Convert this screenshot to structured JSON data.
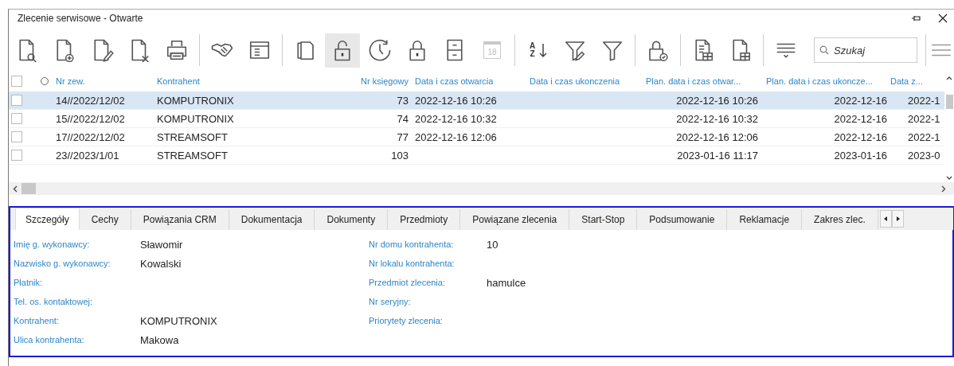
{
  "window": {
    "title": "Zlecenie serwisowe - Otwarte"
  },
  "toolbar": [
    {
      "kind": "doc-search",
      "pressed": false,
      "disabled": false
    },
    {
      "kind": "doc-add",
      "pressed": false,
      "disabled": false
    },
    {
      "kind": "doc-edit",
      "pressed": false,
      "disabled": false
    },
    {
      "kind": "doc-delete",
      "pressed": false,
      "disabled": false
    },
    {
      "kind": "printer",
      "pressed": false,
      "disabled": false
    },
    {
      "kind": "separator"
    },
    {
      "kind": "handshake",
      "pressed": false,
      "disabled": false
    },
    {
      "kind": "form",
      "pressed": false,
      "disabled": false
    },
    {
      "kind": "separator"
    },
    {
      "kind": "copy",
      "pressed": false,
      "disabled": false
    },
    {
      "kind": "unlock",
      "pressed": true,
      "disabled": false
    },
    {
      "kind": "clock",
      "pressed": false,
      "disabled": false
    },
    {
      "kind": "lock",
      "pressed": false,
      "disabled": false
    },
    {
      "kind": "cabinet",
      "pressed": false,
      "disabled": false
    },
    {
      "kind": "calendar",
      "label": "18",
      "pressed": false,
      "disabled": true
    },
    {
      "kind": "separator"
    },
    {
      "kind": "sort",
      "label": "A Z",
      "pressed": false,
      "disabled": false
    },
    {
      "kind": "filter-edit",
      "pressed": false,
      "disabled": false
    },
    {
      "kind": "filter",
      "pressed": false,
      "disabled": false
    },
    {
      "kind": "separator"
    },
    {
      "kind": "lock-check",
      "pressed": false,
      "disabled": false
    },
    {
      "kind": "separator"
    },
    {
      "kind": "doc-table",
      "pressed": false,
      "disabled": false
    },
    {
      "kind": "doc-table-alt",
      "pressed": false,
      "disabled": false
    },
    {
      "kind": "separator"
    },
    {
      "kind": "collapse",
      "pressed": false,
      "disabled": false
    },
    {
      "kind": "search",
      "placeholder": "Szukaj"
    },
    {
      "kind": "separator"
    },
    {
      "kind": "menu",
      "pressed": false,
      "disabled": false
    }
  ],
  "table": {
    "select_all_checked": false,
    "columns": [
      "Nr zew.",
      "Kontrahent",
      "Nr księgowy",
      "Data i czas otwarcia",
      "Data i czas ukonczenia",
      "Plan. data i czas otwar...",
      "Plan. data i czas ukoncze...",
      "Data z..."
    ],
    "rows": [
      {
        "selected": true,
        "checked": false,
        "cells": [
          "14//2022/12/02",
          "KOMPUTRONIX",
          "73",
          "2022-12-16 10:26",
          null,
          "2022-12-16 10:26",
          "2022-12-16",
          "2022-1"
        ]
      },
      {
        "selected": false,
        "checked": false,
        "cells": [
          "15//2022/12/02",
          "KOMPUTRONIX",
          "74",
          "2022-12-16 10:32",
          null,
          "2022-12-16 10:32",
          "2022-12-16",
          "2022-1"
        ]
      },
      {
        "selected": false,
        "checked": false,
        "cells": [
          "17//2022/12/02",
          "STREAMSOFT",
          "77",
          "2022-12-16 12:06",
          null,
          "2022-12-16 12:06",
          "2022-12-16",
          "2022-1"
        ]
      },
      {
        "selected": false,
        "checked": false,
        "cells": [
          "23//2023/1/01",
          "STREAMSOFT",
          "103",
          null,
          null,
          "2023-01-16 11:17",
          "2023-01-16",
          "2023-0"
        ]
      }
    ]
  },
  "tabs": [
    {
      "label": "Szczegóły",
      "selected": true
    },
    {
      "label": "Cechy",
      "selected": false
    },
    {
      "label": "Powiązania CRM",
      "selected": false
    },
    {
      "label": "Dokumentacja",
      "selected": false
    },
    {
      "label": "Dokumenty",
      "selected": false
    },
    {
      "label": "Przedmioty",
      "selected": false
    },
    {
      "label": "Powiązane zlecenia",
      "selected": false
    },
    {
      "label": "Start-Stop",
      "selected": false
    },
    {
      "label": "Podsumowanie",
      "selected": false
    },
    {
      "label": "Reklamacje",
      "selected": false
    },
    {
      "label": "Zakres zlec.",
      "selected": false
    }
  ],
  "details": {
    "left": [
      {
        "label": "Imię g. wykonawcy:",
        "value": "Sławomir"
      },
      {
        "label": "Nazwisko g. wykonawcy:",
        "value": "Kowalski"
      },
      {
        "label": "Płatnik:"
      },
      {
        "label": "Tel. os. kontaktowej:"
      },
      {
        "label": "Kontrahent:",
        "value": "KOMPUTRONIX"
      },
      {
        "label": "Ulica kontrahenta:",
        "value": "Makowa"
      }
    ],
    "right": [
      {
        "label": "Nr domu kontrahenta:",
        "value": "10"
      },
      {
        "label": "Nr lokalu kontrahenta:"
      },
      {
        "label": "Przedmiot zlecenia:",
        "value": "hamulce"
      },
      {
        "label": "Nr seryjny:"
      },
      {
        "label": "Priorytety zlecenia:"
      }
    ]
  }
}
